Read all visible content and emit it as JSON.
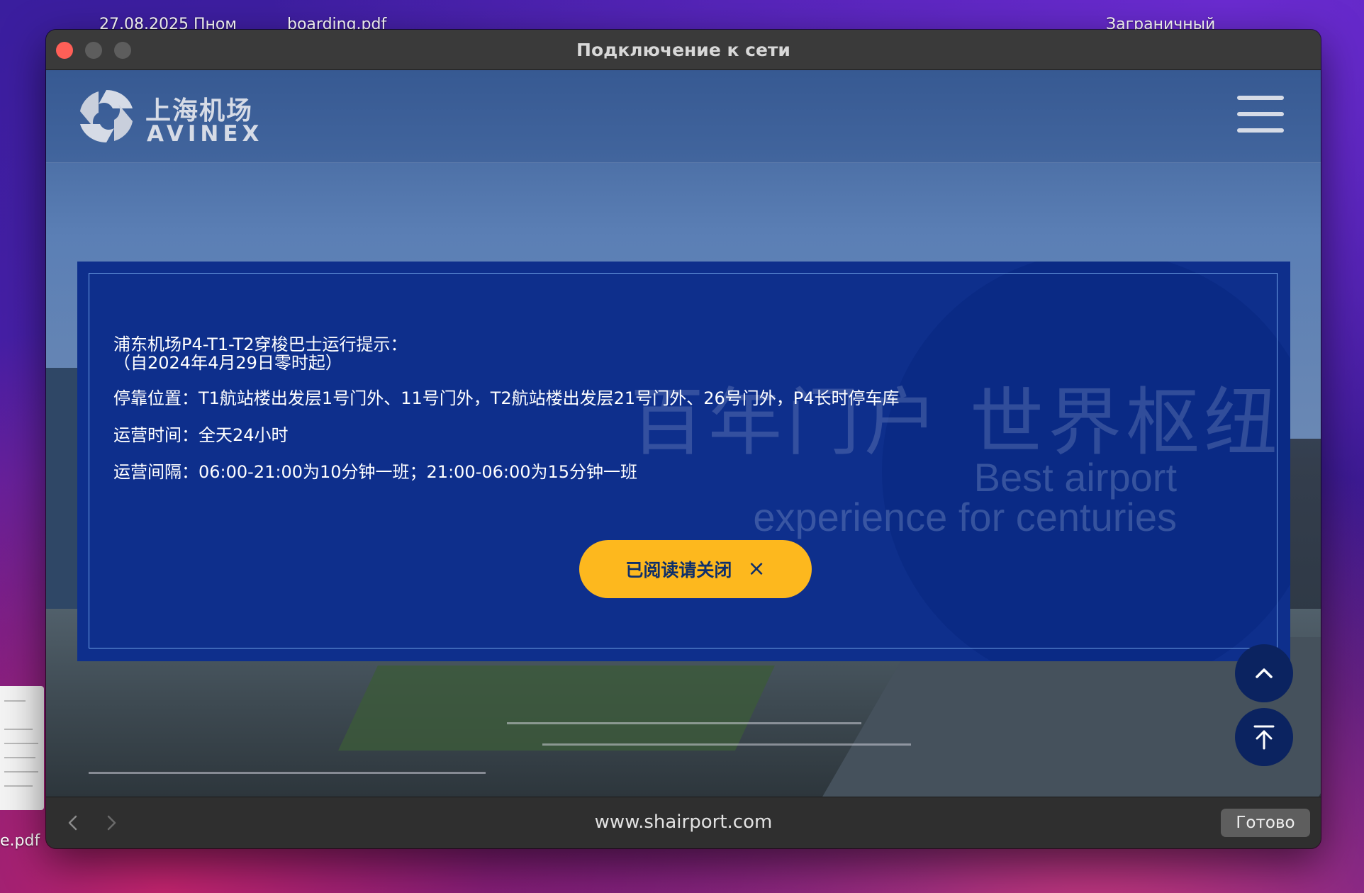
{
  "desktop": {
    "top_left_label": "27.08.2025  Пном",
    "top_middle_label": "boarding.pdf",
    "top_right_label": "Заграничный",
    "bottom_left_label": "e.pdf"
  },
  "window": {
    "title": "Подключение к сети"
  },
  "site_header": {
    "logo_cn": "上海机场",
    "logo_en": "AVINEX",
    "logo_icon": "airport-logo-icon",
    "menu_icon": "hamburger-menu-icon"
  },
  "background_slogan": {
    "cn": "百年门户 世界枢纽",
    "en_line1": "Best airport",
    "en_line2": "experience for centuries"
  },
  "notice": {
    "title_line1": "浦东机场P4-T1-T2穿梭巴士运行提示：",
    "title_line2": "（自2024年4月29日零时起）",
    "stops": "停靠位置：T1航站楼出发层1号门外、11号门外，T2航站楼出发层21号门外、26号门外，P4长时停车库",
    "hours": "运营时间：全天24小时",
    "interval": "运营间隔：06:00-21:00为10分钟一班；21:00-06:00为15分钟一班",
    "close_button_label": "已阅读请关闭",
    "close_button_icon": "×"
  },
  "floating": {
    "up_icon": "chevron-up-icon",
    "top_icon": "back-to-top-icon"
  },
  "bottom_bar": {
    "url": "www.shairport.com",
    "done_label": "Готово"
  },
  "colors": {
    "modal_bg": "#0e2f8c",
    "button_yellow": "#fdb81e",
    "close_red": "#ff5f57"
  }
}
